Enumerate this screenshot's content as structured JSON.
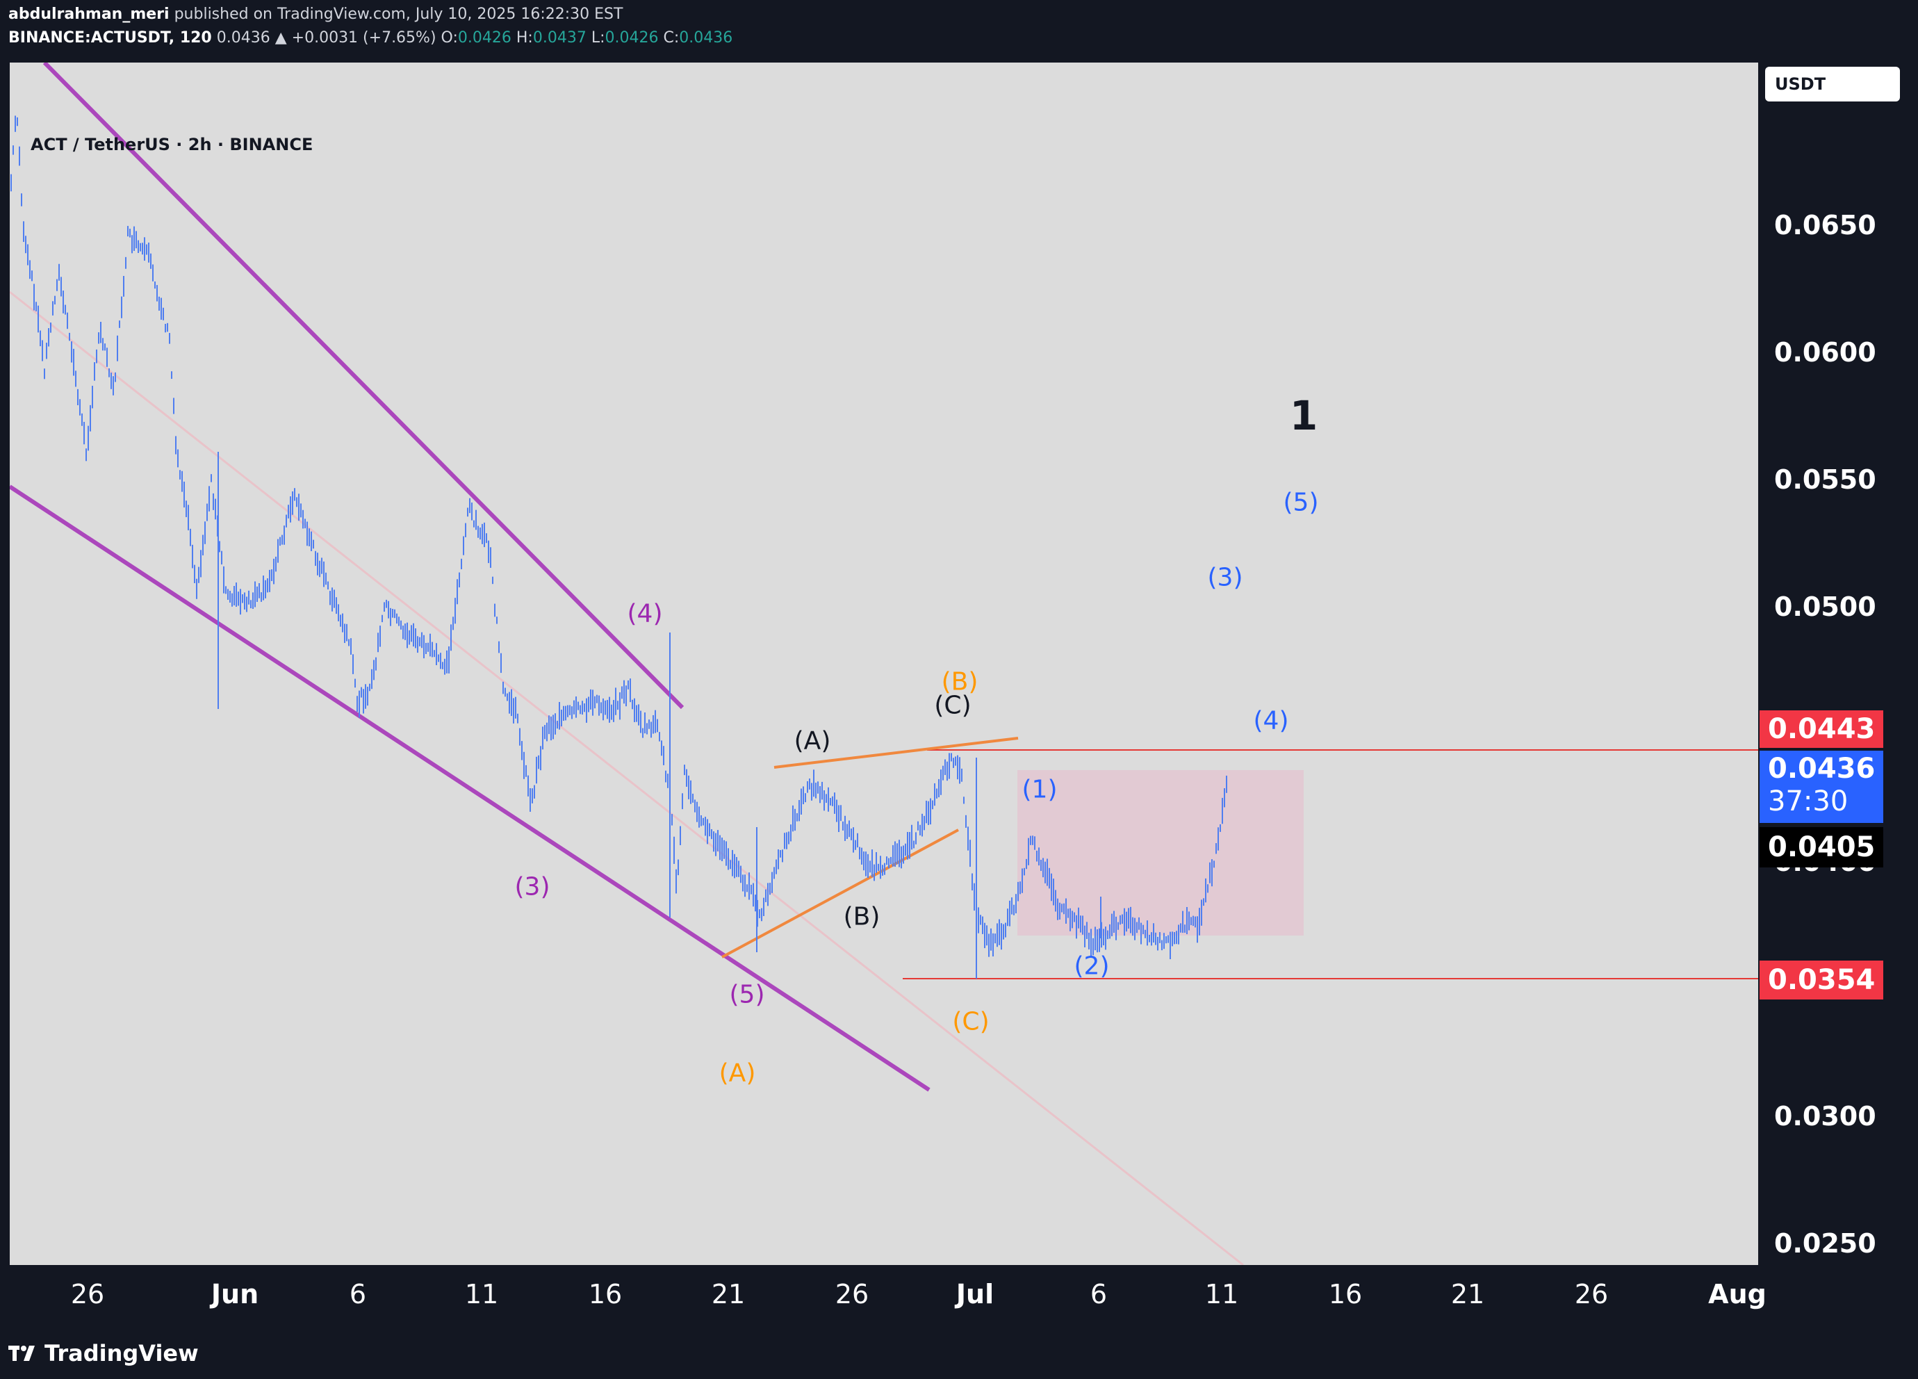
{
  "header": {
    "author": "abdulrahman_meri",
    "published": "published on TradingView.com, July 10, 2025 16:22:30 EST",
    "symbol": "BINANCE:ACTUSDT, 120",
    "last": "0.0436",
    "change": "▲ +0.0031 (+7.65%)",
    "o_label": "O:",
    "o_val": "0.0426",
    "h_label": "H:",
    "h_val": "0.0437",
    "l_label": "L:",
    "l_val": "0.0426",
    "c_label": "C:",
    "c_val": "0.0436"
  },
  "chart": {
    "legend": "ACT / TetherUS · 2h · BINANCE",
    "currency": "USDT",
    "colors": {
      "candles": "#4f7ef0",
      "channel": "#ab47bc",
      "orange": "#f0883e",
      "red_line": "#e53935",
      "zone": "#e8b4c8",
      "blue_label": "#2962ff",
      "purple_label": "#9c27b0",
      "orange_label": "#ff9800",
      "black_label": "#131722"
    }
  },
  "y_axis": {
    "ticks": [
      "0.0650",
      "0.0600",
      "0.0550",
      "0.0500",
      "0.0300",
      "0.0250"
    ],
    "hidden_tick": "0.0400",
    "tags": {
      "upper": "0.0443",
      "current": "0.0436",
      "countdown": "37:30",
      "previous": "0.0405",
      "lower": "0.0354"
    }
  },
  "x_axis": {
    "ticks": [
      {
        "label": "26",
        "bold": false
      },
      {
        "label": "Jun",
        "bold": true
      },
      {
        "label": "6",
        "bold": false
      },
      {
        "label": "11",
        "bold": false
      },
      {
        "label": "16",
        "bold": false
      },
      {
        "label": "21",
        "bold": false
      },
      {
        "label": "26",
        "bold": false
      },
      {
        "label": "Jul",
        "bold": true
      },
      {
        "label": "6",
        "bold": false
      },
      {
        "label": "11",
        "bold": false
      },
      {
        "label": "16",
        "bold": false
      },
      {
        "label": "21",
        "bold": false
      },
      {
        "label": "26",
        "bold": false
      },
      {
        "label": "Aug",
        "bold": true
      }
    ]
  },
  "waves": {
    "purple": [
      "(3)",
      "(4)",
      "(5)"
    ],
    "orange": [
      "(A)",
      "(B)",
      "(C)"
    ],
    "black": [
      "(A)",
      "(B)",
      "(C)",
      "1"
    ],
    "blue": [
      "(1)",
      "(2)",
      "(3)",
      "(4)",
      "(5)"
    ]
  },
  "footer": {
    "brand": "TradingView"
  }
}
